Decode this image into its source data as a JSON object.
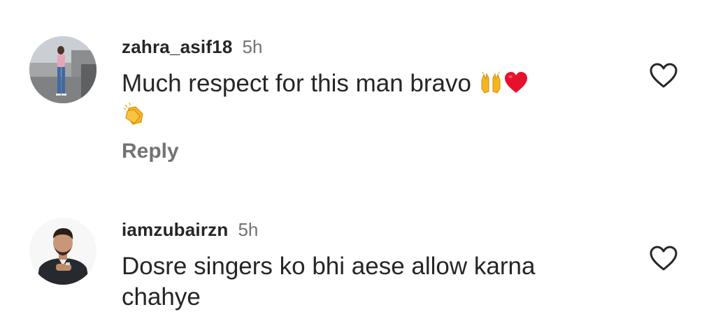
{
  "comments": [
    {
      "username": "zahra_asif18",
      "time": "5h",
      "text": "Much respect for this man bravo",
      "emojis": [
        "raising-hands",
        "red-heart",
        "clapping-hands"
      ],
      "reply_label": "Reply"
    },
    {
      "username": "iamzubairzn",
      "time": "5h",
      "text": "Dosre singers ko bhi aese allow karna chahye"
    }
  ],
  "colors": {
    "text": "#262626",
    "secondary": "#737373",
    "background": "#ffffff"
  }
}
